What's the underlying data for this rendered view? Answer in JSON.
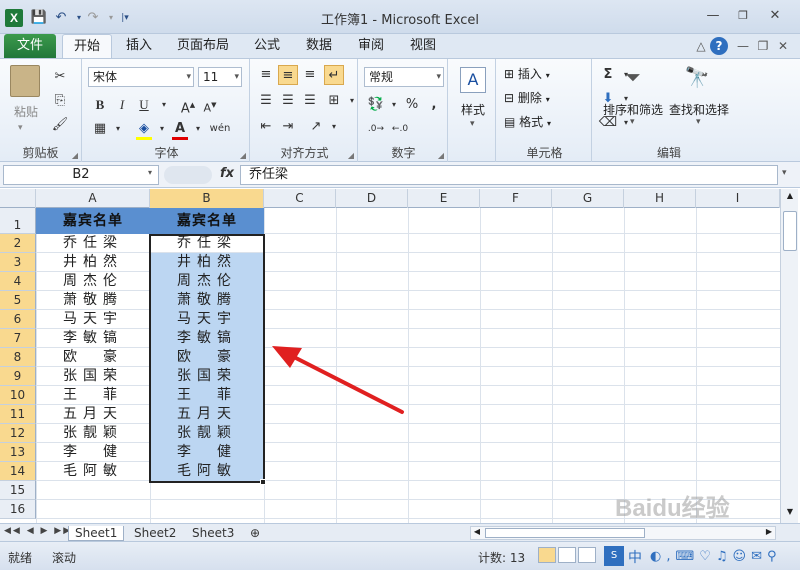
{
  "window": {
    "title": "工作簿1 - Microsoft Excel",
    "app_icon": "X"
  },
  "quick_access": [
    "save-icon",
    "undo-icon",
    "redo-icon",
    "customize-icon"
  ],
  "tabs": {
    "file": "文件",
    "items": [
      "开始",
      "插入",
      "页面布局",
      "公式",
      "数据",
      "审阅",
      "视图"
    ]
  },
  "ribbon": {
    "clipboard": {
      "paste": "粘贴",
      "label": "剪贴板"
    },
    "font": {
      "name": "宋体",
      "size": "11",
      "label": "字体",
      "bold": "B",
      "italic": "I",
      "underline": "U",
      "phonetic": "wén"
    },
    "alignment": {
      "label": "对齐方式"
    },
    "number": {
      "format": "常规",
      "label": "数字",
      "percent": "%",
      "comma": ","
    },
    "styles": {
      "label": "样式"
    },
    "cells": {
      "insert": "插入",
      "delete": "删除",
      "format": "格式",
      "label": "单元格"
    },
    "editing": {
      "sort": "排序和筛选",
      "find": "查找和选择",
      "label": "编辑",
      "sum": "Σ"
    }
  },
  "formula_bar": {
    "name_box": "B2",
    "fx": "fx",
    "value": "乔任梁"
  },
  "columns": [
    "A",
    "B",
    "C",
    "D",
    "E",
    "F",
    "G",
    "H",
    "I"
  ],
  "rows": [
    "1",
    "2",
    "3",
    "4",
    "5",
    "6",
    "7",
    "8",
    "9",
    "10",
    "11",
    "12",
    "13",
    "14",
    "15",
    "16"
  ],
  "sheet": {
    "header": "嘉宾名单",
    "names_a": [
      "乔任梁",
      "井柏然",
      "周杰伦",
      "萧敬腾",
      "马天宇",
      "李敏镐",
      "欧　豪",
      "张国荣",
      "王　菲",
      "五月天",
      "张靓颖",
      "李　健",
      "毛阿敏"
    ],
    "names_b": [
      "乔任梁",
      "井柏然",
      "周杰伦",
      "萧敬腾",
      "马天宇",
      "李敏镐",
      "欧　豪",
      "张国荣",
      "王　菲",
      "五月天",
      "张靓颖",
      "李　健",
      "毛阿敏"
    ]
  },
  "sheet_tabs": [
    "Sheet1",
    "Sheet2",
    "Sheet3"
  ],
  "status": {
    "ready": "就绪",
    "scroll": "滚动",
    "count": "计数: 13",
    "ime": "中"
  },
  "watermark": "Baidu经验",
  "colors": {
    "header_fill": "#5a8fd0",
    "selection": "#bcd6f2",
    "arrow": "#e02020",
    "file_tab": "#21773a"
  }
}
